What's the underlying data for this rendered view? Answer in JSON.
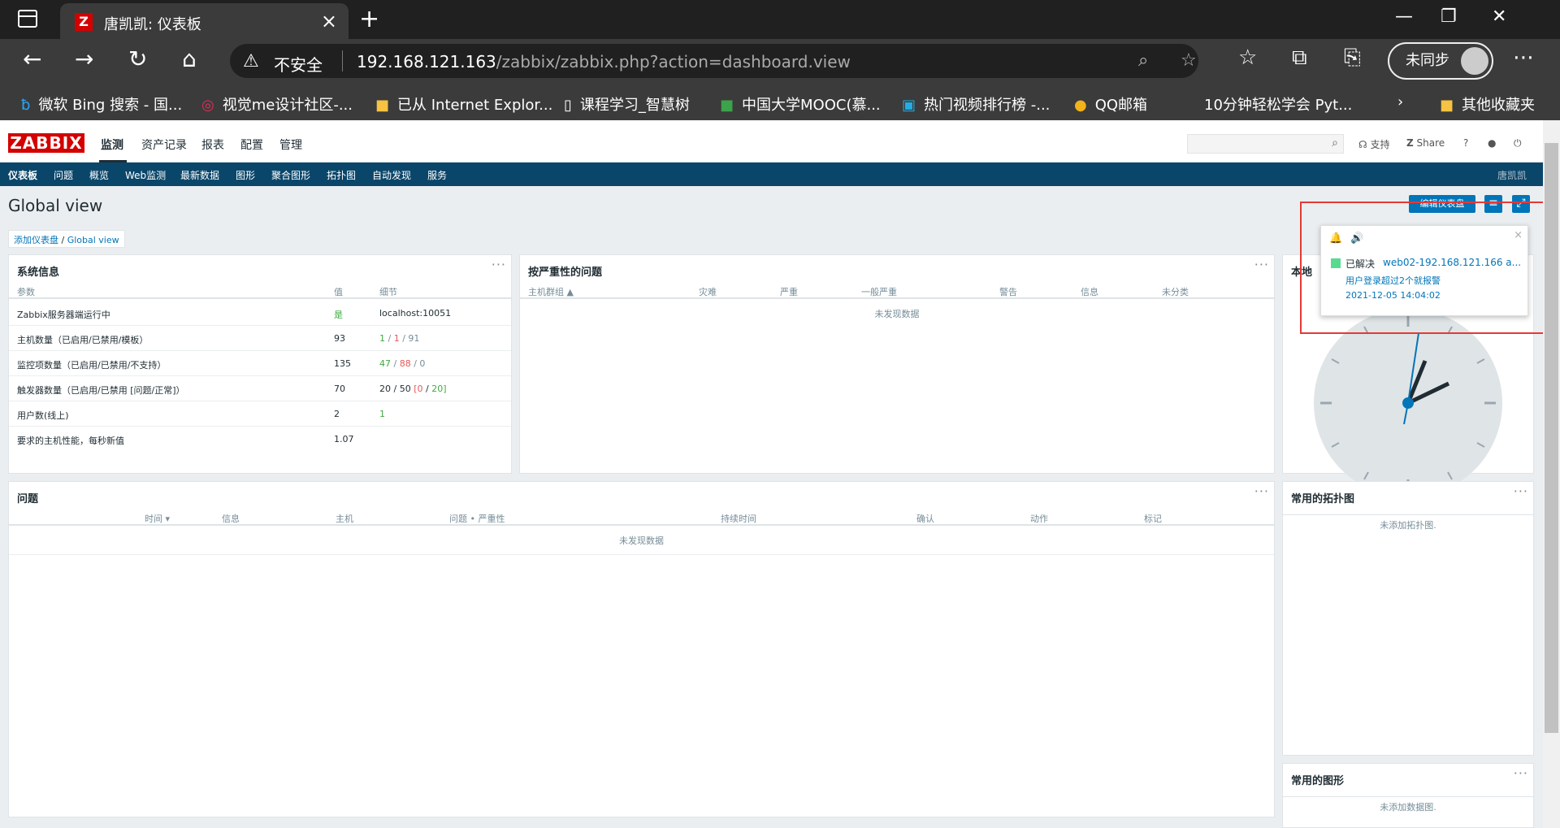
{
  "browser": {
    "tab_title": "唐凯凯: 仪表板",
    "tab_favicon": "Z",
    "url_warning": "不安全",
    "url_host": "192.168.121.163",
    "url_path": "/zabbix/zabbix.php?action=dashboard.view",
    "sync_label": "未同步",
    "bookmarks": [
      "微软 Bing 搜索 - 国...",
      "视觉me设计社区-...",
      "已从 Internet Explor...",
      "课程学习_智慧树",
      "中国大学MOOC(慕...",
      "热门视频排行榜 -...",
      "QQ邮箱",
      "10分钟轻松学会 Pyt...",
      "其他收藏夹"
    ]
  },
  "zabbix": {
    "logo": "ZABBIX",
    "main_menu": [
      "监测",
      "资产记录",
      "报表",
      "配置",
      "管理"
    ],
    "header_links": {
      "support": "支持",
      "share": "Share",
      "help": "?"
    },
    "sub_menu": [
      "仪表板",
      "问题",
      "概览",
      "Web监测",
      "最新数据",
      "图形",
      "聚合图形",
      "拓扑图",
      "自动发现",
      "服务"
    ],
    "user": "唐凯凯",
    "page_title": "Global view",
    "edit_button": "编辑仪表盘",
    "breadcrumb": [
      "添加仪表盘",
      "Global view"
    ],
    "sysinfo": {
      "title": "系统信息",
      "headers": [
        "参数",
        "值",
        "细节"
      ],
      "rows": [
        {
          "param": "Zabbix服务器端运行中",
          "value": "是",
          "detail": "localhost:10051"
        },
        {
          "param": "主机数量（已启用/已禁用/模板）",
          "value": "93",
          "d1": "1",
          "d2": "1",
          "d3": "91"
        },
        {
          "param": "监控项数量（已启用/已禁用/不支持）",
          "value": "135",
          "d1": "47",
          "d2": "88",
          "d3": "0"
        },
        {
          "param": "触发器数量（已启用/已禁用 [问题/正常]）",
          "value": "70",
          "d1": "20",
          "d2": "50",
          "d3": "0",
          "d4": "20"
        },
        {
          "param": "用户数(线上)",
          "value": "2",
          "detail": "1"
        },
        {
          "param": "要求的主机性能，每秒新值",
          "value": "1.07",
          "detail": ""
        }
      ]
    },
    "severity": {
      "title": "按严重性的问题",
      "headers": [
        "主机群组 ▲",
        "灾难",
        "严重",
        "一般严重",
        "警告",
        "信息",
        "未分类"
      ],
      "empty": "未发现数据"
    },
    "clock": {
      "title": "本地"
    },
    "problems": {
      "title": "问题",
      "headers": [
        "时间 ▾",
        "信息",
        "主机",
        "问题 • 严重性",
        "持续时间",
        "确认",
        "动作",
        "标记"
      ],
      "empty": "未发现数据"
    },
    "maps": {
      "title": "常用的拓扑图",
      "empty": "未添加拓扑图."
    },
    "graphs": {
      "title": "常用的图形",
      "empty": "未添加数据图."
    },
    "notification": {
      "status": "已解决",
      "host": "web02-192.168.121.166 a...",
      "message": "用户登录超过2个就报警",
      "time": "2021-12-05 14:04:02"
    }
  }
}
